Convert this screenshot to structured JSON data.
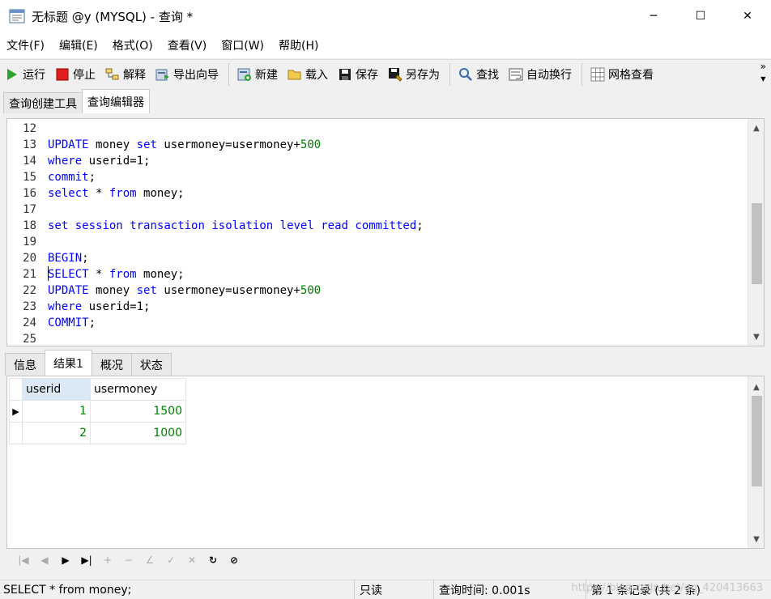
{
  "window": {
    "title": "无标题 @y (MYSQL) - 查询 *",
    "minimize": "─",
    "maximize": "☐",
    "close": "✕"
  },
  "menu": [
    "文件(F)",
    "编辑(E)",
    "格式(O)",
    "查看(V)",
    "窗口(W)",
    "帮助(H)"
  ],
  "toolbar": {
    "run": "运行",
    "stop": "停止",
    "explain": "解释",
    "export_wizard": "导出向导",
    "new": "新建",
    "load": "载入",
    "save": "保存",
    "save_as": "另存为",
    "find": "查找",
    "word_wrap": "自动换行",
    "grid_view": "网格查看",
    "more": "»"
  },
  "top_tabs": [
    "查询创建工具",
    "查询编辑器"
  ],
  "editor": {
    "lines": [
      {
        "n": "12",
        "code": ""
      },
      {
        "n": "13",
        "code": "UPDATE money set usermoney=usermoney+500"
      },
      {
        "n": "14",
        "code": "where userid=1;"
      },
      {
        "n": "15",
        "code": "commit;"
      },
      {
        "n": "16",
        "code": "select * from money;"
      },
      {
        "n": "17",
        "code": ""
      },
      {
        "n": "18",
        "code": "set session transaction isolation level read committed;"
      },
      {
        "n": "19",
        "code": ""
      },
      {
        "n": "20",
        "code": "BEGIN;"
      },
      {
        "n": "21",
        "code": "SELECT * from money;"
      },
      {
        "n": "22",
        "code": "UPDATE money set usermoney=usermoney+500"
      },
      {
        "n": "23",
        "code": "where userid=1;"
      },
      {
        "n": "24",
        "code": "COMMIT;"
      },
      {
        "n": "25",
        "code": ""
      }
    ],
    "keyword_color": "#0000ff",
    "number_color": "#008000"
  },
  "bottom_tabs": [
    "信息",
    "结果1",
    "概况",
    "状态"
  ],
  "results": {
    "columns": [
      "userid",
      "usermoney"
    ],
    "rows": [
      [
        "1",
        "1500"
      ],
      [
        "2",
        "1000"
      ]
    ],
    "current_row_marker": "▶"
  },
  "status": {
    "sql": "SELECT * from money;",
    "mode": "只读",
    "query_time": "查询时间: 0.001s",
    "record": "第 1 条记录 (共 2 条)",
    "watermark": "https://blog.csdn.net/qq_420413663"
  }
}
